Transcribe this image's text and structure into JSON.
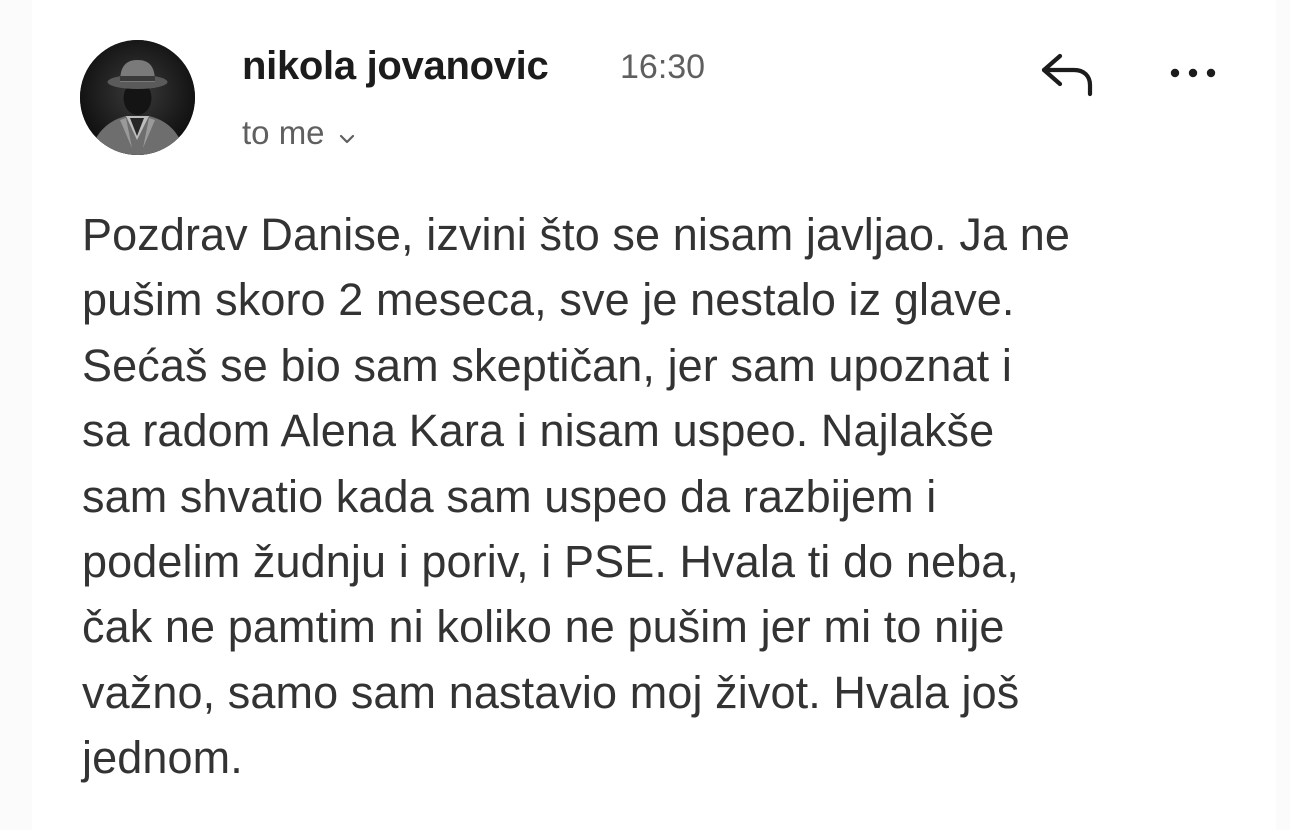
{
  "message": {
    "sender_name": "nikola jovanovic",
    "time": "16:30",
    "recipient_label": "to me",
    "body_lines": [
      "Pozdrav Danise, izvini što se nisam javljao. Ja ne",
      "pušim skoro 2 meseca, sve je nestalo iz glave.",
      "Sećaš se bio sam skeptičan, jer sam upoznat i",
      "sa radom Alena Kara i nisam uspeo. Najlakše",
      "sam shvatio kada sam uspeo da razbijem i",
      "podelim žudnju i poriv, i PSE. Hvala ti do neba,",
      "čak ne pamtim ni koliko ne pušim jer mi to nije",
      "važno, samo sam nastavio moj život. Hvala još",
      "jednom."
    ]
  },
  "icons": {
    "avatar": "avatar-photo",
    "reply": "reply-arrow-icon",
    "more": "more-options-icon",
    "chevron": "chevron-down-icon"
  },
  "colors": {
    "sender": "#1c1c1c",
    "secondary": "#5f5f5f",
    "body": "#333333",
    "background": "#ffffff"
  }
}
